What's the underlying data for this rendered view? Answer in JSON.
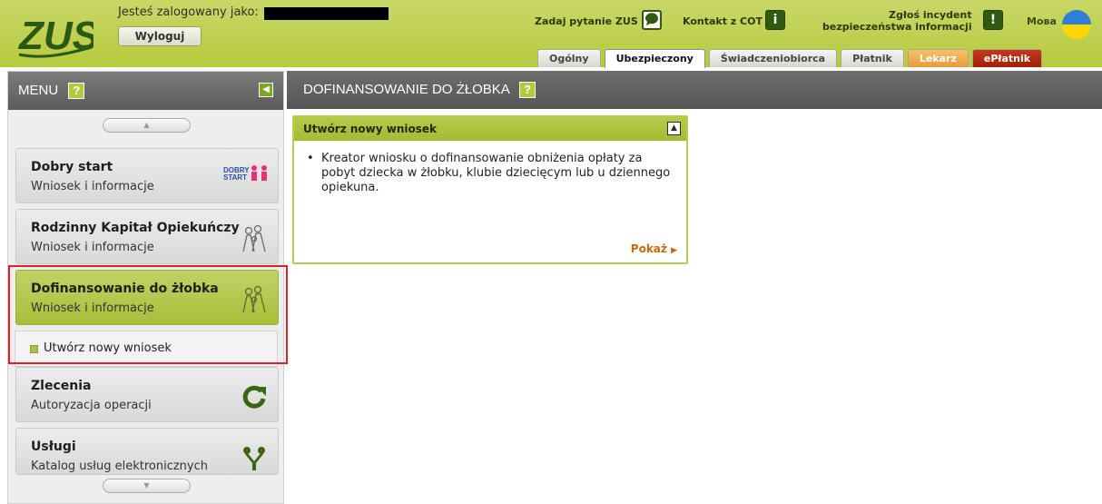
{
  "header": {
    "logo_text": "ZUS",
    "logged_in_label": "Jesteś zalogowany jako:",
    "logout_label": "Wyloguj",
    "ask_label": "Zadaj pytanie ZUS",
    "contact_label": "Kontakt z COT",
    "contact_icon": "i",
    "incident_label_1": "Zgłoś incydent",
    "incident_label_2": "bezpieczeństwa informacji",
    "incident_icon": "!",
    "language_label": "Мова"
  },
  "tabs": [
    {
      "label": "Ogólny"
    },
    {
      "label": "Ubezpieczony"
    },
    {
      "label": "Świadczeniobiorca"
    },
    {
      "label": "Płatnik"
    },
    {
      "label": "Lekarz"
    },
    {
      "label": "ePłatnik"
    }
  ],
  "sidebar": {
    "title": "MENU",
    "help": "?",
    "items": [
      {
        "title": "Dobry start",
        "subtitle": "Wniosek i informacje",
        "icon": "dobry-start-logo-icon",
        "icon_text": "DOBRY START"
      },
      {
        "title": "Rodzinny Kapitał Opiekuńczy",
        "subtitle": "Wniosek i informacje",
        "icon": "family-icon"
      },
      {
        "title": "Dofinansowanie do żłobka",
        "subtitle": "Wniosek i informacje",
        "icon": "family-icon"
      },
      {
        "title": "Zlecenia",
        "subtitle": "Autoryzacja operacji",
        "icon": "refresh-icon"
      },
      {
        "title": "Usługi",
        "subtitle": "Katalog usług elektronicznych",
        "icon": "services-icon"
      }
    ],
    "submenu": [
      {
        "label": "Utwórz nowy wniosek"
      }
    ]
  },
  "main": {
    "title": "DOFINANSOWANIE DO ŻŁOBKA",
    "help": "?",
    "card": {
      "title": "Utwórz nowy wniosek",
      "body": "Kreator wniosku o dofinansowanie obniżenia opłaty za pobyt dziecka w żłobku, klubie dziecięcym lub u dziennego opiekuna.",
      "more_label": "Pokaż"
    }
  },
  "colors": {
    "header_green": "#b7ca3e",
    "active_menu": "#a8bf39",
    "highlight_red": "#e01f2b",
    "dark_gray": "#5b5b5b",
    "link_orange": "#c66a0c"
  }
}
